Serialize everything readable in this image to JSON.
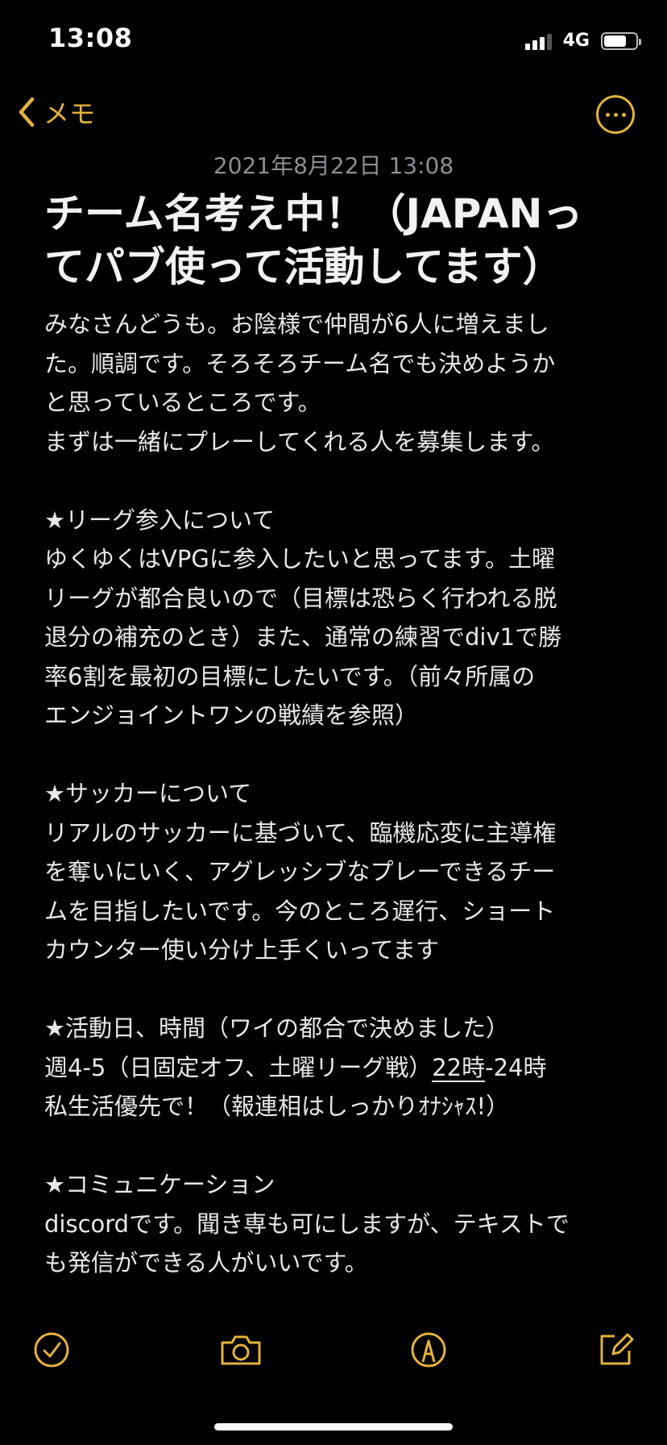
{
  "status_bar": {
    "time": "13:08",
    "network": "4G",
    "signal_bars": 3,
    "battery_level": 0.7
  },
  "nav": {
    "back_label": "メモ",
    "accent_color": "#e2b23d"
  },
  "note": {
    "date": "2021年8月22日 13:08",
    "title_lines": [
      "チーム名考え中！（JAPANっ",
      "てパブ使って活動してます）"
    ],
    "body_lines": [
      "みなさんどうも。お陰様で仲間が6人に増えまし",
      "た。順調です。そろそろチーム名でも決めようか",
      "と思っているところです。",
      "まずは一緒にプレーしてくれる人を募集します。",
      "",
      "★リーグ参入について",
      "ゆくゆくはVPGに参入したいと思ってます。土曜",
      "リーグが都合良いので（目標は恐らく行われる脱",
      "退分の補充のとき）また、通常の練習でdiv1で勝",
      "率6割を最初の目標にしたいです。（前々所属の",
      "エンジョイントワンの戦績を参照）",
      "",
      "★サッカーについて",
      "リアルのサッカーに基づいて、臨機応変に主導権",
      "を奪いにいく、アグレッシブなプレーできるチー",
      "ムを目指したいです。今のところ遅行、ショート",
      "カウンター使い分け上手くいってます",
      "",
      "★活動日、時間（ワイの都合で決めました）"
    ],
    "schedule_line": {
      "prefix": "週4-5（日固定オフ、土曜リーグ戦）",
      "underlined": "22時",
      "suffix": "-24時"
    },
    "body_lines_after": [
      "私生活優先で！（報連相はしっかりｵﾅｼｬｽ!）",
      "",
      "★コミュニケーション",
      "discordです。聞き専も可にしますが、テキストで",
      "も発信ができる人がいいです。"
    ]
  },
  "toolbar": {
    "icons": [
      "checklist-icon",
      "camera-icon",
      "markup-pen-icon",
      "compose-icon"
    ]
  }
}
